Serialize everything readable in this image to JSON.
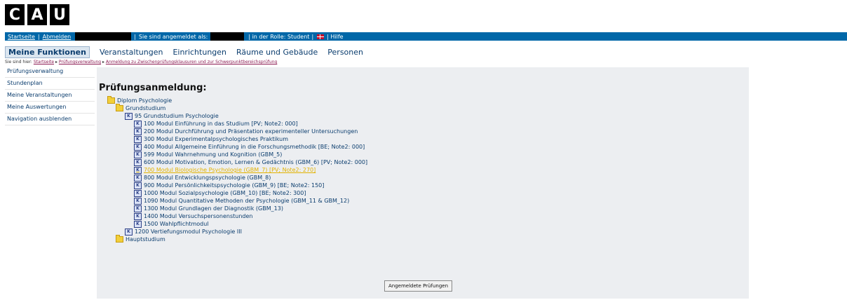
{
  "logo": {
    "letters": [
      "C",
      "A",
      "U"
    ]
  },
  "topbar": {
    "startseite": "Startseite",
    "sep1": "|",
    "abmelden": "Abmelden",
    "sep2": "|",
    "angemeldet": "Sie sind angemeldet als:",
    "rolle": "| in der Rolle: Student",
    "sep3": "|",
    "hilfe": "| Hilfe"
  },
  "mainnav": {
    "active": "Meine Funktionen",
    "items": [
      "Veranstaltungen",
      "Einrichtungen",
      "Räume und Gebäude",
      "Personen"
    ]
  },
  "breadcrumb": {
    "label": "Sie sind hier:",
    "items": [
      "Startseite",
      "Prüfungsverwaltung",
      "Anmeldung zu Zwischenprüfungsklausuren und zur Schwerpunktbereichsprüfung"
    ]
  },
  "sidebar": {
    "items": [
      "Prüfungsverwaltung",
      "Stundenplan",
      "Meine Veranstaltungen",
      "Meine Auswertungen",
      "Navigation ausblenden"
    ]
  },
  "content": {
    "title": "Prüfungsanmeldung:",
    "tree": [
      {
        "label": "Diplom Psychologie",
        "type": "folder",
        "level": 0
      },
      {
        "label": "Grundstudium",
        "type": "folder",
        "level": 1
      },
      {
        "label": "95 Grundstudium Psychologie",
        "type": "module",
        "level": 2
      },
      {
        "label": "100 Modul Einführung in das Studium  [PV; Note2: 000]",
        "type": "module",
        "level": 3
      },
      {
        "label": "200 Modul Durchführung und Präsentation experimenteller Untersuchungen",
        "type": "module",
        "level": 3
      },
      {
        "label": "300 Modul Experimentalpsychologisches Praktikum",
        "type": "module",
        "level": 3
      },
      {
        "label": "400 Modul Allgemeine Einführung in die Forschungsmethodik  [BE; Note2: 000]",
        "type": "module",
        "level": 3
      },
      {
        "label": "599 Modul Wahrnehmung und Kognition (GBM_5)",
        "type": "module",
        "level": 3
      },
      {
        "label": "600 Modul Motivation, Emotion, Lernen & Gedächtnis (GBM_6)  [PV; Note2: 000]",
        "type": "module",
        "level": 3
      },
      {
        "label": "700 Modul Biologische Psychologie (GBM_7)  [PV; Note2: 270]",
        "type": "module",
        "level": 3,
        "selected": true
      },
      {
        "label": "800 Modul Entwicklungspsychologie (GBM_8)",
        "type": "module",
        "level": 3
      },
      {
        "label": "900 Modul Persönlichkeitspsychologie (GBM_9)  [BE; Note2: 150]",
        "type": "module",
        "level": 3
      },
      {
        "label": "1000 Modul Sozialpsychologie (GBM_10)  [BE; Note2: 300]",
        "type": "module",
        "level": 3
      },
      {
        "label": "1090 Modul Quantitative Methoden der Psychologie (GBM_11 & GBM_12)",
        "type": "module",
        "level": 3
      },
      {
        "label": "1300 Modul Grundlagen der Diagnostik (GBM_13)",
        "type": "module",
        "level": 3
      },
      {
        "label": "1400 Modul Versuchspersonenstunden",
        "type": "module",
        "level": 3
      },
      {
        "label": "1500 Wahlpflichtmodul",
        "type": "module",
        "level": 3
      },
      {
        "label": "1200 Vertiefungsmodul Psychologie III",
        "type": "module",
        "level": 2
      },
      {
        "label": "Hauptstudium",
        "type": "folder",
        "level": 1
      }
    ],
    "button": "Angemeldete Prüfungen"
  },
  "colors": {
    "topbar": "#0067a8",
    "selected": "#e2b200",
    "panel": "#eceef1"
  }
}
